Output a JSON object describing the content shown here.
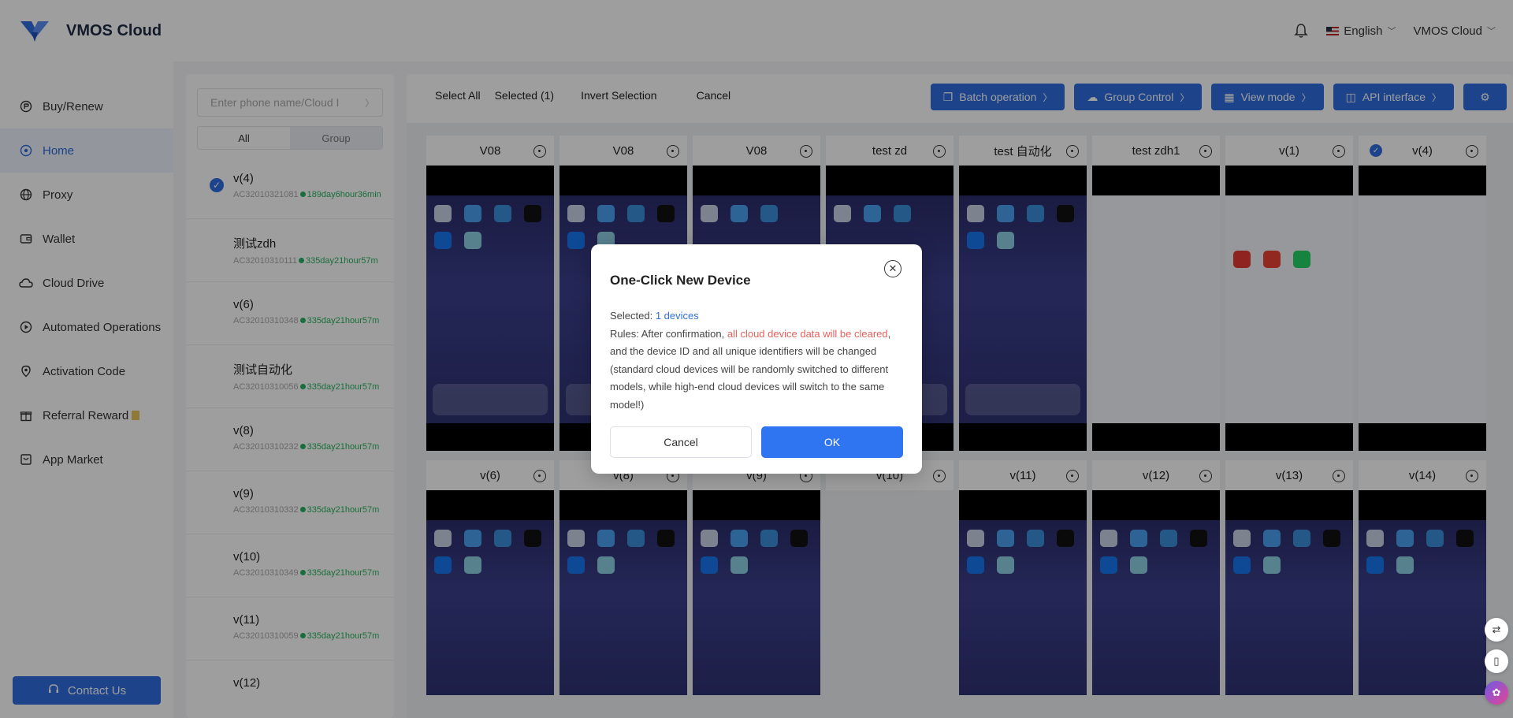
{
  "header": {
    "brand": "VMOS Cloud",
    "language": "English",
    "account": "VMOS Cloud"
  },
  "sidebar": {
    "items": [
      {
        "label": "Buy/Renew",
        "icon": "buy-icon"
      },
      {
        "label": "Home",
        "icon": "home-icon",
        "active": true
      },
      {
        "label": "Proxy",
        "icon": "globe-icon"
      },
      {
        "label": "Wallet",
        "icon": "wallet-icon"
      },
      {
        "label": "Cloud Drive",
        "icon": "cloud-icon"
      },
      {
        "label": "Automated Operations",
        "icon": "play-icon"
      },
      {
        "label": "Activation Code",
        "icon": "pin-icon"
      },
      {
        "label": "Referral Reward",
        "icon": "gift-icon"
      },
      {
        "label": "App Market",
        "icon": "market-icon"
      }
    ],
    "contact": "Contact Us"
  },
  "list": {
    "search_placeholder": "Enter phone name/Cloud I",
    "seg_all": "All",
    "seg_group": "Group",
    "devices": [
      {
        "name": "v(4)",
        "id": "AC32010321081",
        "time": "189day6hour36min",
        "checked": true
      },
      {
        "name": "测试zdh",
        "id": "AC32010310111",
        "time": "335day21hour57m"
      },
      {
        "name": "v(6)",
        "id": "AC32010310348",
        "time": "335day21hour57m"
      },
      {
        "name": "测试自动化",
        "id": "AC32010310056",
        "time": "335day21hour57m"
      },
      {
        "name": "v(8)",
        "id": "AC32010310232",
        "time": "335day21hour57m"
      },
      {
        "name": "v(9)",
        "id": "AC32010310332",
        "time": "335day21hour57m"
      },
      {
        "name": "v(10)",
        "id": "AC32010310349",
        "time": "335day21hour57m"
      },
      {
        "name": "v(11)",
        "id": "AC32010310059",
        "time": "335day21hour57m"
      },
      {
        "name": "v(12)",
        "id": "",
        "time": ""
      }
    ]
  },
  "toolbar": {
    "select_all": "Select All",
    "selected": "Selected (1)",
    "invert": "Invert Selection",
    "cancel": "Cancel"
  },
  "actions": {
    "batch": "Batch operation",
    "group": "Group Control",
    "view": "View mode",
    "api": "API interface"
  },
  "cards_row1": [
    "V08",
    "V08",
    "V08",
    "test zd",
    "test 自动化",
    "test zdh1",
    "v(1)",
    "v(4)"
  ],
  "cards_row2": [
    "v(6)",
    "v(8)",
    "v(9)",
    "v(10)",
    "v(11)",
    "v(12)",
    "v(13)",
    "v(14)"
  ],
  "modal": {
    "title": "One-Click New Device",
    "selected_label": "Selected: ",
    "selected_value": "1 devices",
    "rules_prefix": "Rules: After confirmation, ",
    "rules_red": "all cloud device data will be cleared",
    "rules_suffix": ", and the device ID and all unique identifiers will be changed (standard cloud devices will be randomly switched to different models, while high-end cloud devices will switch to the same model!)",
    "cancel": "Cancel",
    "ok": "OK"
  },
  "colors": {
    "accent": "#2f6fe0",
    "warning_text": "#e8605b",
    "online": "#28b463"
  }
}
